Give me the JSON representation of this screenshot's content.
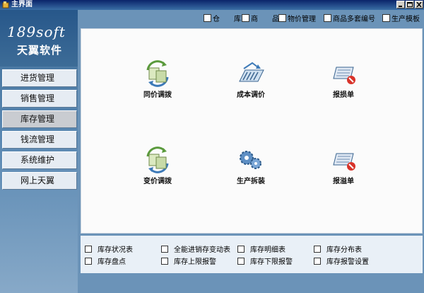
{
  "window": {
    "title": "主界面"
  },
  "logo": {
    "brand": "189soft",
    "name": "天翼软件"
  },
  "nav": [
    "进货管理",
    "销售管理",
    "库存管理",
    "钱流管理",
    "系统维护",
    "网上天翼"
  ],
  "nav_active": "库存管理",
  "top_options": [
    "仓　　库",
    "商　　品",
    "物价管理",
    "商品多套编号",
    "生产模板"
  ],
  "functions": [
    "同价调拨",
    "成本调价",
    "报损单",
    "变价调拨",
    "生产拆装",
    "报溢单"
  ],
  "reports": [
    "库存状况表",
    "全能进销存变动表",
    "库存明细表",
    "库存分布表",
    "库存盘点",
    "库存上限报警",
    "库存下限报警",
    "库存报警设置"
  ],
  "colors": {
    "titlebar": "#0a246a",
    "sidebar": "#3e6d97",
    "background": "#6b93b8",
    "panel": "#fbfbfb",
    "bottom_panel": "#e9f0f7"
  }
}
